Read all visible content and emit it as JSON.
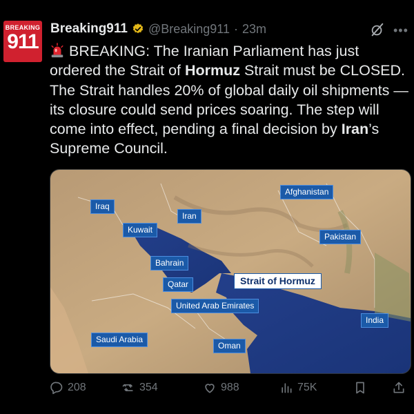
{
  "avatar": {
    "top_text": "BREAKING",
    "main_text": "911"
  },
  "header": {
    "name": "Breaking911",
    "handle": "@Breaking911",
    "separator": "·",
    "time": "23m"
  },
  "tweet": {
    "alarm_icon": "police-light-emoji",
    "segments": [
      {
        "text": "BREAKING: The  Iranian Parliament has just ordered the Strait of ",
        "bold": false
      },
      {
        "text": "Hormuz",
        "bold": true
      },
      {
        "text": " Strait must be CLOSED. The Strait handles 20% of global daily oil shipments — its closure could send prices soaring. The step will come into effect, pending a final decision by ",
        "bold": false
      },
      {
        "text": "Iran",
        "bold": true
      },
      {
        "text": "’s Supreme Council.",
        "bold": false
      }
    ]
  },
  "map": {
    "labels": {
      "afghanistan": "Afghanistan",
      "iraq": "Iraq",
      "iran": "Iran",
      "kuwait": "Kuwait",
      "pakistan": "Pakistan",
      "bahrain": "Bahrain",
      "qatar": "Qatar",
      "strait": "Strait of Hormuz",
      "uae": "United Arab Emirates",
      "india": "India",
      "saudi": "Saudi Arabia",
      "oman": "Oman"
    },
    "colors": {
      "sea": "#1f3f8f",
      "land": "#c2a47e",
      "label_bg": "#1b5aa8"
    }
  },
  "actions": {
    "replies": "208",
    "reposts": "354",
    "likes": "988",
    "views": "75K"
  },
  "colors": {
    "accent_red": "#d0212f",
    "muted": "#71767b",
    "verified_gold": "#e2b719"
  }
}
